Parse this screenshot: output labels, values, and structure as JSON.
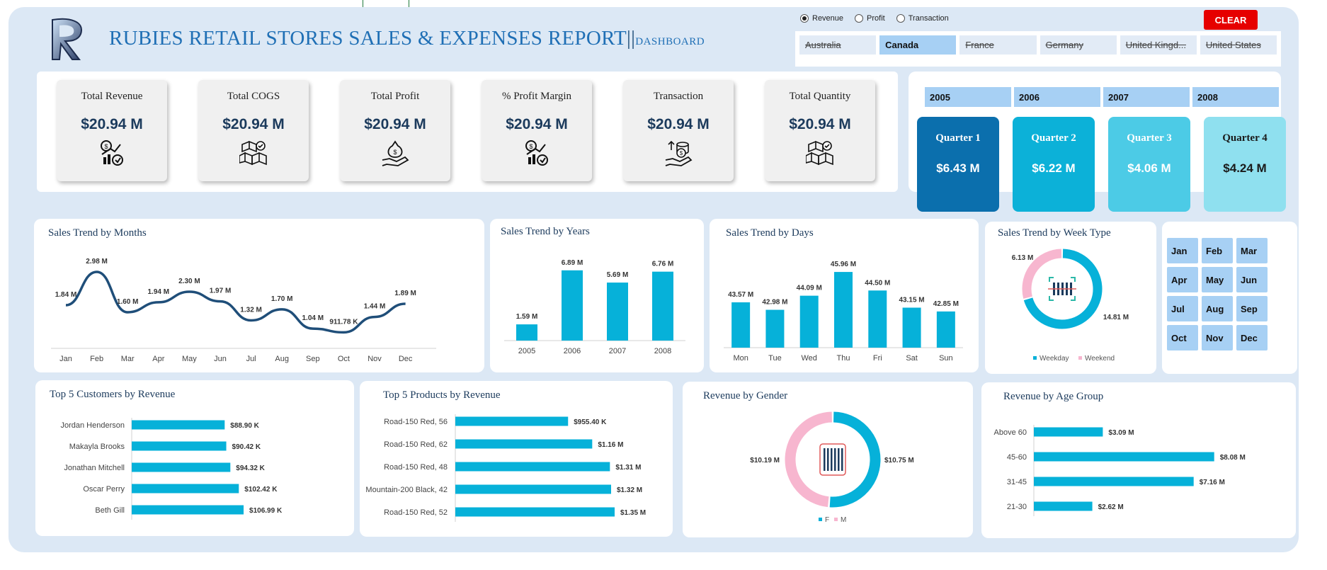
{
  "header": {
    "title": "RUBIES RETAIL STORES SALES & EXPENSES REPORT",
    "separator": "||",
    "subtitle": "DASHBOARD"
  },
  "measure_options": [
    {
      "label": "Revenue",
      "selected": true
    },
    {
      "label": "Profit",
      "selected": false
    },
    {
      "label": "Transaction",
      "selected": false
    }
  ],
  "clear_label": "CLEAR",
  "countries": [
    {
      "label": "Australia",
      "active": false
    },
    {
      "label": "Canada",
      "active": true
    },
    {
      "label": "France",
      "active": false
    },
    {
      "label": "Germany",
      "active": false
    },
    {
      "label": "United Kingd...",
      "active": false
    },
    {
      "label": "United States",
      "active": false
    }
  ],
  "kpis": [
    {
      "label": "Total Revenue",
      "value": "$20.94 M",
      "icon": "growth-chart-icon"
    },
    {
      "label": "Total COGS",
      "value": "$20.94 M",
      "icon": "boxes-icon"
    },
    {
      "label": "Total Profit",
      "value": "$20.94 M",
      "icon": "money-bag-hand-icon"
    },
    {
      "label": "% Profit Margin",
      "value": "$20.94 M",
      "icon": "growth-chart-icon"
    },
    {
      "label": "Transaction",
      "value": "$20.94 M",
      "icon": "coins-hand-icon"
    },
    {
      "label": "Total Quantity",
      "value": "$20.94 M",
      "icon": "boxes-icon"
    }
  ],
  "years": [
    "2005",
    "2006",
    "2007",
    "2008"
  ],
  "quarters": [
    {
      "label": "Quarter 1",
      "value": "$6.43 M",
      "color": "#0b6fad",
      "text_color": "#ffffff"
    },
    {
      "label": "Quarter 2",
      "value": "$6.22 M",
      "color": "#0cb1d8",
      "text_color": "#ffffff"
    },
    {
      "label": "Quarter 3",
      "value": "$4.06 M",
      "color": "#4ccbe6",
      "text_color": "#ffffff"
    },
    {
      "label": "Quarter 4",
      "value": "$4.24 M",
      "color": "#8fe0ef",
      "text_color": "#1a1a1a"
    }
  ],
  "month_buttons": [
    "Jan",
    "Feb",
    "Mar",
    "Apr",
    "May",
    "Jun",
    "Jul",
    "Aug",
    "Sep",
    "Oct",
    "Nov",
    "Dec"
  ],
  "colors": {
    "accent": "#06b1d9",
    "line": "#1f4e79",
    "pink": "#f7b6cf",
    "title_blue": "#1f6fb5"
  },
  "chart_data": [
    {
      "id": "months",
      "type": "line",
      "title": "Sales Trend by Months",
      "categories": [
        "Jan",
        "Feb",
        "Mar",
        "Apr",
        "May",
        "Jun",
        "Jul",
        "Aug",
        "Sep",
        "Oct",
        "Nov",
        "Dec"
      ],
      "values": [
        1.84,
        2.98,
        1.6,
        1.94,
        2.3,
        1.97,
        1.32,
        1.7,
        1.04,
        0.91178,
        1.44,
        1.89
      ],
      "labels": [
        "1.84 M",
        "2.98 M",
        "1.60 M",
        "1.94 M",
        "2.30 M",
        "1.97 M",
        "1.32 M",
        "1.70 M",
        "1.04 M",
        "911.78 K",
        "1.44 M",
        "1.89 M"
      ],
      "ylim": [
        0,
        3.2
      ]
    },
    {
      "id": "years",
      "type": "bar",
      "title": "Sales Trend by Years",
      "categories": [
        "2005",
        "2006",
        "2007",
        "2008"
      ],
      "values": [
        1.59,
        6.89,
        5.69,
        6.76
      ],
      "labels": [
        "1.59 M",
        "6.89 M",
        "5.69 M",
        "6.76 M"
      ],
      "ylim": [
        0,
        7.5
      ]
    },
    {
      "id": "days",
      "type": "bar",
      "title": "Sales Trend by Days",
      "categories": [
        "Mon",
        "Tue",
        "Wed",
        "Thu",
        "Fri",
        "Sat",
        "Sun"
      ],
      "values": [
        43.57,
        42.98,
        44.09,
        45.96,
        44.5,
        43.15,
        42.85
      ],
      "labels": [
        "43.57 M",
        "42.98 M",
        "44.09 M",
        "45.96 M",
        "44.50 M",
        "43.15 M",
        "42.85 M"
      ],
      "ylim": [
        40,
        46.8
      ]
    },
    {
      "id": "weektype",
      "type": "pie",
      "title": "Sales Trend by Week Type",
      "categories": [
        "Weekday",
        "Weekend"
      ],
      "values": [
        14.81,
        6.13
      ],
      "labels": [
        "14.81 M",
        "6.13 M"
      ],
      "legend": "bottom"
    },
    {
      "id": "customers",
      "type": "bar",
      "title": "Top 5 Customers by Revenue",
      "categories": [
        "Jordan Henderson",
        "Makayla Brooks",
        "Jonathan Mitchell",
        "Oscar Perry",
        "Beth Gill"
      ],
      "values": [
        88.9,
        90.42,
        94.32,
        102.42,
        106.99
      ],
      "labels": [
        "$88.90 K",
        "$90.42 K",
        "$94.32 K",
        "$102.42 K",
        "$106.99 K"
      ],
      "ylim": [
        0,
        130
      ]
    },
    {
      "id": "products",
      "type": "bar",
      "title": "Top 5 Products by Revenue",
      "categories": [
        "Road-150 Red, 56",
        "Road-150 Red, 62",
        "Road-150 Red, 48",
        "Mountain-200 Black, 42",
        "Road-150 Red, 52"
      ],
      "values": [
        0.9554,
        1.16,
        1.31,
        1.32,
        1.35
      ],
      "labels": [
        "$955.40 K",
        "$1.16 M",
        "$1.31 M",
        "$1.32 M",
        "$1.35 M"
      ],
      "ylim": [
        0,
        1.5
      ]
    },
    {
      "id": "gender",
      "type": "pie",
      "title": "Revenue by Gender",
      "categories": [
        "F",
        "M"
      ],
      "values": [
        10.75,
        10.19
      ],
      "labels": [
        "$10.75 M",
        "$10.19 M"
      ],
      "legend": "bottom"
    },
    {
      "id": "age",
      "type": "bar",
      "title": "Revenue by Age Group",
      "categories": [
        "Above 60",
        "45-60",
        "31-45",
        "21-30"
      ],
      "values": [
        3.09,
        8.08,
        7.16,
        2.62
      ],
      "labels": [
        "$3.09 M",
        "$8.08 M",
        "$7.16 M",
        "$2.62 M"
      ],
      "ylim": [
        0,
        9.2
      ]
    }
  ]
}
